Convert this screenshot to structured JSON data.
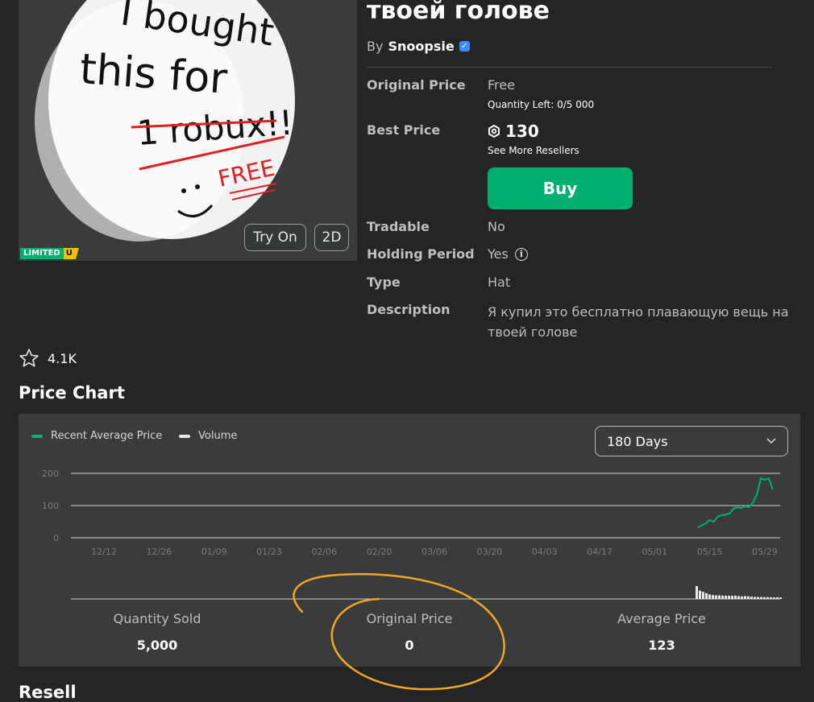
{
  "item": {
    "title": "твоей голове",
    "by_prefix": "By",
    "creator": "Snoopsie",
    "verified_icon": "verified-badge-icon",
    "thumbnail_buttons": {
      "try_on": "Try On",
      "view_2d": "2D"
    },
    "badge": {
      "limited": "LIMITED",
      "unique": "U"
    },
    "thumbnail_text": {
      "line1": "I bought",
      "line2": "this for",
      "line3": "1 robux!!",
      "line4": "FREE"
    }
  },
  "details": {
    "original_price_label": "Original Price",
    "original_price_value": "Free",
    "quantity_left": "Quantity Left: 0/5 000",
    "best_price_label": "Best Price",
    "best_price_value": "130",
    "see_more_resellers": "See More Resellers",
    "buy_label": "Buy",
    "tradable_label": "Tradable",
    "tradable_value": "No",
    "holding_label": "Holding Period",
    "holding_value": "Yes",
    "type_label": "Type",
    "type_value": "Hat",
    "description_label": "Description",
    "description_value": "Я купил это бесплатно плавающую вещь на твоей голове"
  },
  "favorites": {
    "count": "4.1K",
    "icon": "star-outline-icon"
  },
  "price_chart": {
    "section_title": "Price Chart",
    "legend_avg": "Recent Average Price",
    "legend_volume": "Volume",
    "range_selected": "180 Days",
    "colors": {
      "avg": "#00b06f",
      "volume": "#e8e8e8",
      "buy": "#00b06f"
    },
    "stats": {
      "quantity_sold_label": "Quantity Sold",
      "quantity_sold_value": "5,000",
      "original_price_label": "Original Price",
      "original_price_value": "0",
      "average_price_label": "Average Price",
      "average_price_value": "123"
    }
  },
  "resellers_peek": "Resell",
  "chart_data": {
    "type": "line",
    "ylim": [
      0,
      200
    ],
    "yticks": [
      "200",
      "100",
      "0"
    ],
    "x_tick_labels": [
      "12/12",
      "12/26",
      "01/09",
      "01/23",
      "02/06",
      "02/20",
      "03/06",
      "03/20",
      "04/03",
      "04/17",
      "05/01",
      "05/15",
      "05/29"
    ],
    "series": [
      {
        "name": "Recent Average Price",
        "points": [
          [
            "05/12",
            32
          ],
          [
            "05/14",
            45
          ],
          [
            "05/15",
            55
          ],
          [
            "05/16",
            50
          ],
          [
            "05/17",
            65
          ],
          [
            "05/18",
            70
          ],
          [
            "05/19",
            72
          ],
          [
            "05/20",
            75
          ],
          [
            "05/21",
            90
          ],
          [
            "05/22",
            95
          ],
          [
            "05/23",
            92
          ],
          [
            "05/24",
            98
          ],
          [
            "05/25",
            95
          ],
          [
            "05/26",
            110
          ],
          [
            "05/27",
            135
          ],
          [
            "05/28",
            185
          ],
          [
            "05/29",
            180
          ],
          [
            "05/30",
            185
          ],
          [
            "05/31",
            150
          ]
        ]
      }
    ],
    "volume_relative": [
      1.0,
      0.65,
      0.55,
      0.45,
      0.35,
      0.3,
      0.28,
      0.28,
      0.26,
      0.25,
      0.25,
      0.24,
      0.26,
      0.22,
      0.2,
      0.22,
      0.2,
      0.18,
      0.16,
      0.15,
      0.15,
      0.14,
      0.14,
      0.13,
      0.12,
      0.13,
      0.12
    ]
  }
}
